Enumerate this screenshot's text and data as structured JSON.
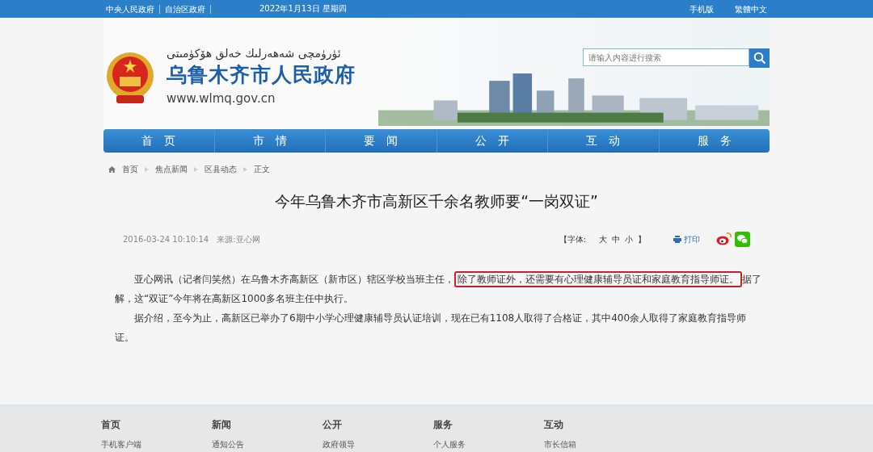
{
  "top_bar": {
    "links": [
      "中央人民政府",
      "自治区政府"
    ],
    "date": "2022年1月13日 星期四",
    "right_links": [
      "手机版",
      "繁體中文"
    ]
  },
  "header": {
    "uyghur_name": "ئۈرۈمچى شەھەرلىك خەلق ھۆكۈمىتى",
    "site_name": "乌鲁木齐市人民政府",
    "url": "www.wlmq.gov.cn",
    "search": {
      "placeholder": "请输入内容进行搜索"
    }
  },
  "nav": [
    {
      "label": "首　页",
      "selected": false
    },
    {
      "label": "市　情",
      "selected": false
    },
    {
      "label": "要　闻",
      "selected": false
    },
    {
      "label": "公　开",
      "selected": false
    },
    {
      "label": "互　动",
      "selected": false
    },
    {
      "label": "服　务",
      "selected": false
    }
  ],
  "breadcrumb": [
    "首页",
    "焦点新闻",
    "区县动态",
    "正文"
  ],
  "article": {
    "title": "今年乌鲁木齐市高新区千余名教师要“一岗双证”",
    "date": "2016-03-24 10:10:14",
    "source": "来源:亚心网",
    "font_size": {
      "open": "【字体:",
      "sizes": [
        "大",
        "中",
        "小"
      ],
      "close": "】"
    },
    "print": "打印",
    "paragraphs": [
      {
        "before": "亚心网讯（记者闫笑然）在乌鲁木齐高新区（新市区）辖区学校当班主任，",
        "highlighted": "除了教师证外，还需要有心理健康辅导员证和家庭教育指导师证。",
        "after": "据了解，这“双证”今年将在高新区1000多名班主任中执行。"
      },
      {
        "before": "据介绍，至今为止，高新区已举办了6期中小学心理健康辅导员认证培训，现在已有1108人取得了合格证，其中400余人取得了家庭教育指导师证。"
      }
    ]
  },
  "footer": [
    {
      "heading": "首页",
      "links": [
        "手机客户端"
      ]
    },
    {
      "heading": "新闻",
      "links": [
        "通知公告"
      ]
    },
    {
      "heading": "公开",
      "links": [
        "政府领导"
      ]
    },
    {
      "heading": "服务",
      "links": [
        "个人服务"
      ]
    },
    {
      "heading": "互动",
      "links": [
        "市长信箱"
      ]
    }
  ]
}
